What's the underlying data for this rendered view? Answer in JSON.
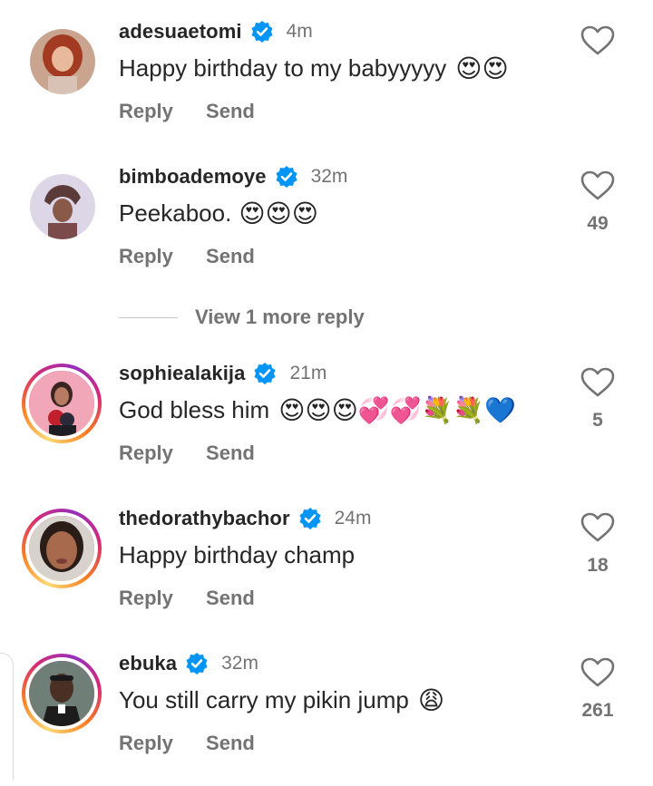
{
  "comments": [
    {
      "username": "adesuaetomi",
      "verified": true,
      "time": "4m",
      "text": "Happy birthday to my babyyyyy",
      "emojis": "😍😍",
      "reply_label": "Reply",
      "send_label": "Send",
      "likes": ""
    },
    {
      "username": "bimboademoye",
      "verified": true,
      "time": "32m",
      "text": "Peekaboo.",
      "emojis": "😍😍😍",
      "reply_label": "Reply",
      "send_label": "Send",
      "likes": "49"
    },
    {
      "username": "sophiealakija",
      "verified": true,
      "time": "21m",
      "text": "God bless him",
      "emojis": "😍😍😍💞💞💐💐💙",
      "reply_label": "Reply",
      "send_label": "Send",
      "likes": "5"
    },
    {
      "username": "thedorathybachor",
      "verified": true,
      "time": "24m",
      "text": "Happy birthday champ",
      "emojis": "",
      "reply_label": "Reply",
      "send_label": "Send",
      "likes": "18"
    },
    {
      "username": "ebuka",
      "verified": true,
      "time": "32m",
      "text": "You still carry my pikin jump",
      "emojis": "😩",
      "reply_label": "Reply",
      "send_label": "Send",
      "likes": "261"
    }
  ],
  "view_more_replies": "View 1 more reply",
  "colors": {
    "verified_badge": "#0095f6",
    "secondary_text": "#737373",
    "primary_text": "#262626"
  },
  "icons": {
    "like": "heart-outline-icon",
    "verified": "verified-badge-icon"
  }
}
